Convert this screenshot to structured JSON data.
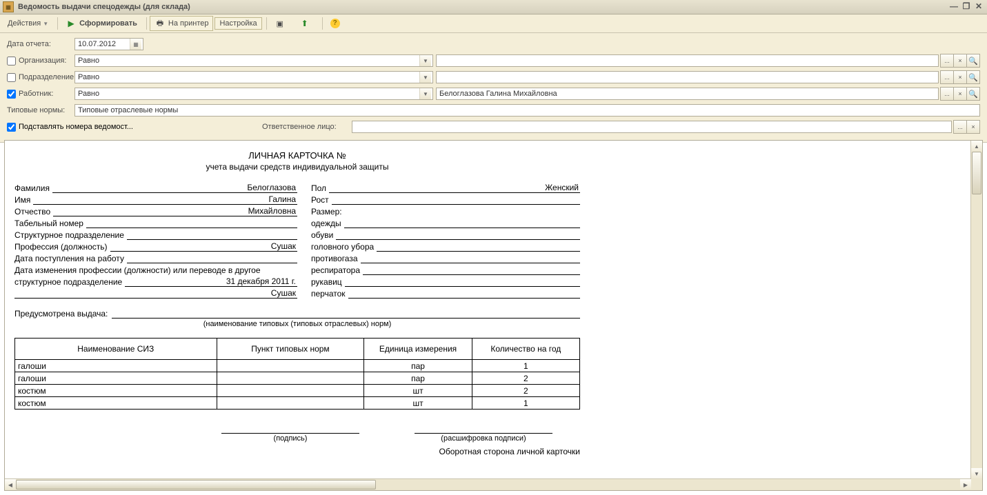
{
  "window": {
    "title": "Ведомость выдачи спецодежды (для склада)"
  },
  "toolbar": {
    "actions": "Действия",
    "generate": "Сформировать",
    "toPrinter": "На принтер",
    "settings": "Настройка"
  },
  "form": {
    "reportDateLabel": "Дата отчета:",
    "reportDate": "10.07.2012",
    "orgLabel": "Организация:",
    "orgMode": "Равно",
    "orgValue": "",
    "deptLabel": "Подразделение:",
    "deptMode": "Равно",
    "deptValue": "",
    "workerLabel": "Работник:",
    "workerMode": "Равно",
    "workerValue": "Белоглазова Галина Михайловна",
    "normLabel": "Типовые нормы:",
    "normValue": "Типовые отраслевые нормы",
    "autoNumLabel": "Подставлять номера ведомост...",
    "respLabel": "Ответственное лицо:",
    "respValue": ""
  },
  "doc": {
    "headerLine1": "ЛИЧНАЯ КАРТОЧКА №",
    "headerLine2": "учета выдачи средств индивидуальной защиты",
    "lastnameCap": "Фамилия",
    "lastnameVal": "Белоглазова",
    "firstnameCap": "Имя",
    "firstnameVal": "Галина",
    "patronymCap": "Отчество",
    "patronymVal": "Михайловна",
    "tabnumCap": "Табельный номер",
    "tabnumVal": "",
    "structCap": "Структурное подразделение",
    "structVal": "",
    "profCap": "Профессия (должность)",
    "profVal": "Сушак",
    "hireCap": "Дата поступления на работу",
    "hireVal": "",
    "changeCap1": "Дата изменения профессии (должности) или переводе в другое",
    "changeCap2": "структурное подразделение",
    "changeVal": "31 декабря 2011 г.",
    "changeVal2": "Сушак",
    "sexCap": "Пол",
    "sexVal": "Женский",
    "heightCap": "Рост",
    "heightVal": "",
    "sizeCap": "Размер:",
    "clothesCap": "одежды",
    "clothesVal": "",
    "shoesCap": "обуви",
    "shoesVal": "",
    "hatCap": "головного убора",
    "hatVal": "",
    "gasCap": "противогаза",
    "gasVal": "",
    "respiratorCap": "респиратора",
    "respiratorVal": "",
    "mittCap": "рукавиц",
    "mittVal": "",
    "glovesCap": "перчаток",
    "glovesVal": "",
    "issueCap": "Предусмотрена выдача:",
    "issueHint": "(наименование типовых (типовых отраслевых) норм)",
    "th1": "Наименование СИЗ",
    "th2": "Пункт типовых норм",
    "th3": "Единица измерения",
    "th4": "Количество на год",
    "rows": [
      {
        "name": "галоши",
        "point": "",
        "unit": "пар",
        "qty": "1"
      },
      {
        "name": "галоши",
        "point": "",
        "unit": "пар",
        "qty": "2"
      },
      {
        "name": "костюм",
        "point": "",
        "unit": "шт",
        "qty": "2"
      },
      {
        "name": "костюм",
        "point": "",
        "unit": "шт",
        "qty": "1"
      }
    ],
    "signCap1": "(подпись)",
    "signCap2": "(расшифровка подписи)",
    "backTitle": "Оборотная сторона личной карточки"
  }
}
